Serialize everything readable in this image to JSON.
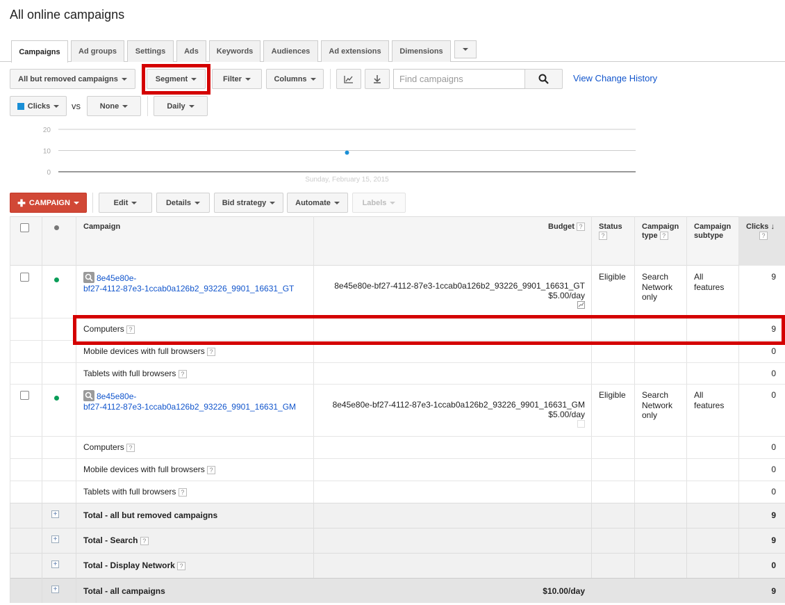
{
  "page": {
    "title": "All online campaigns"
  },
  "tabs": [
    "Campaigns",
    "Ad groups",
    "Settings",
    "Ads",
    "Keywords",
    "Audiences",
    "Ad extensions",
    "Dimensions"
  ],
  "toolbar": {
    "filter_scope": "All but removed campaigns",
    "segment": "Segment",
    "filter": "Filter",
    "columns": "Columns",
    "search_placeholder": "Find campaigns",
    "view_change_history": "View Change History"
  },
  "chart_controls": {
    "metric1": "Clicks",
    "vs": "vs",
    "metric2": "None",
    "period": "Daily"
  },
  "chart_data": {
    "type": "line",
    "x": [
      "Sunday, February 15, 2015"
    ],
    "series": [
      {
        "name": "Clicks",
        "values": [
          9
        ]
      }
    ],
    "yticks": [
      0,
      10,
      20
    ],
    "ylim": [
      0,
      20
    ],
    "colors": {
      "Clicks": "#1a8fd6"
    }
  },
  "actions": {
    "campaign": "CAMPAIGN",
    "edit": "Edit",
    "details": "Details",
    "bid_strategy": "Bid strategy",
    "automate": "Automate",
    "labels": "Labels"
  },
  "table": {
    "headers": {
      "campaign": "Campaign",
      "budget": "Budget",
      "status": "Status",
      "campaign_type_1": "Campaign",
      "campaign_type_2": "type",
      "campaign_subtype_1": "Campaign",
      "campaign_subtype_2": "subtype",
      "clicks": "Clicks"
    },
    "campaigns": [
      {
        "name_line1": "8e45e80e-",
        "name_line2": "bf27-4112-87e3-1ccab0a126b2_93226_9901_16631_GT",
        "budget_name": "8e45e80e-bf27-4112-87e3-1ccab0a126b2_93226_9901_16631_GT",
        "budget_amount": "$5.00/day",
        "status": "Eligible",
        "type_1": "Search",
        "type_2": "Network",
        "type_3": "only",
        "subtype_1": "All",
        "subtype_2": "features",
        "clicks": "9",
        "segments": [
          {
            "label": "Computers",
            "clicks": "9"
          },
          {
            "label": "Mobile devices with full browsers",
            "clicks": "0"
          },
          {
            "label": "Tablets with full browsers",
            "clicks": "0"
          }
        ]
      },
      {
        "name_line1": "8e45e80e-",
        "name_line2": "bf27-4112-87e3-1ccab0a126b2_93226_9901_16631_GM",
        "budget_name": "8e45e80e-bf27-4112-87e3-1ccab0a126b2_93226_9901_16631_GM",
        "budget_amount": "$5.00/day",
        "status": "Eligible",
        "type_1": "Search",
        "type_2": "Network",
        "type_3": "only",
        "subtype_1": "All",
        "subtype_2": "features",
        "clicks": "0",
        "segments": [
          {
            "label": "Computers",
            "clicks": "0"
          },
          {
            "label": "Mobile devices with full browsers",
            "clicks": "0"
          },
          {
            "label": "Tablets with full browsers",
            "clicks": "0"
          }
        ]
      }
    ],
    "totals": [
      {
        "label": "Total - all but removed campaigns",
        "budget": "",
        "clicks": "9"
      },
      {
        "label": "Total - Search",
        "budget": "",
        "clicks": "9"
      },
      {
        "label": "Total - Display Network",
        "budget": "",
        "clicks": "0"
      },
      {
        "label": "Total - all campaigns",
        "budget": "$10.00/day",
        "clicks": "9"
      }
    ]
  },
  "colors": {
    "highlight": "#d40000",
    "link": "#1155cc",
    "add_button": "#d14836",
    "status_dot": "#0a9d58"
  }
}
